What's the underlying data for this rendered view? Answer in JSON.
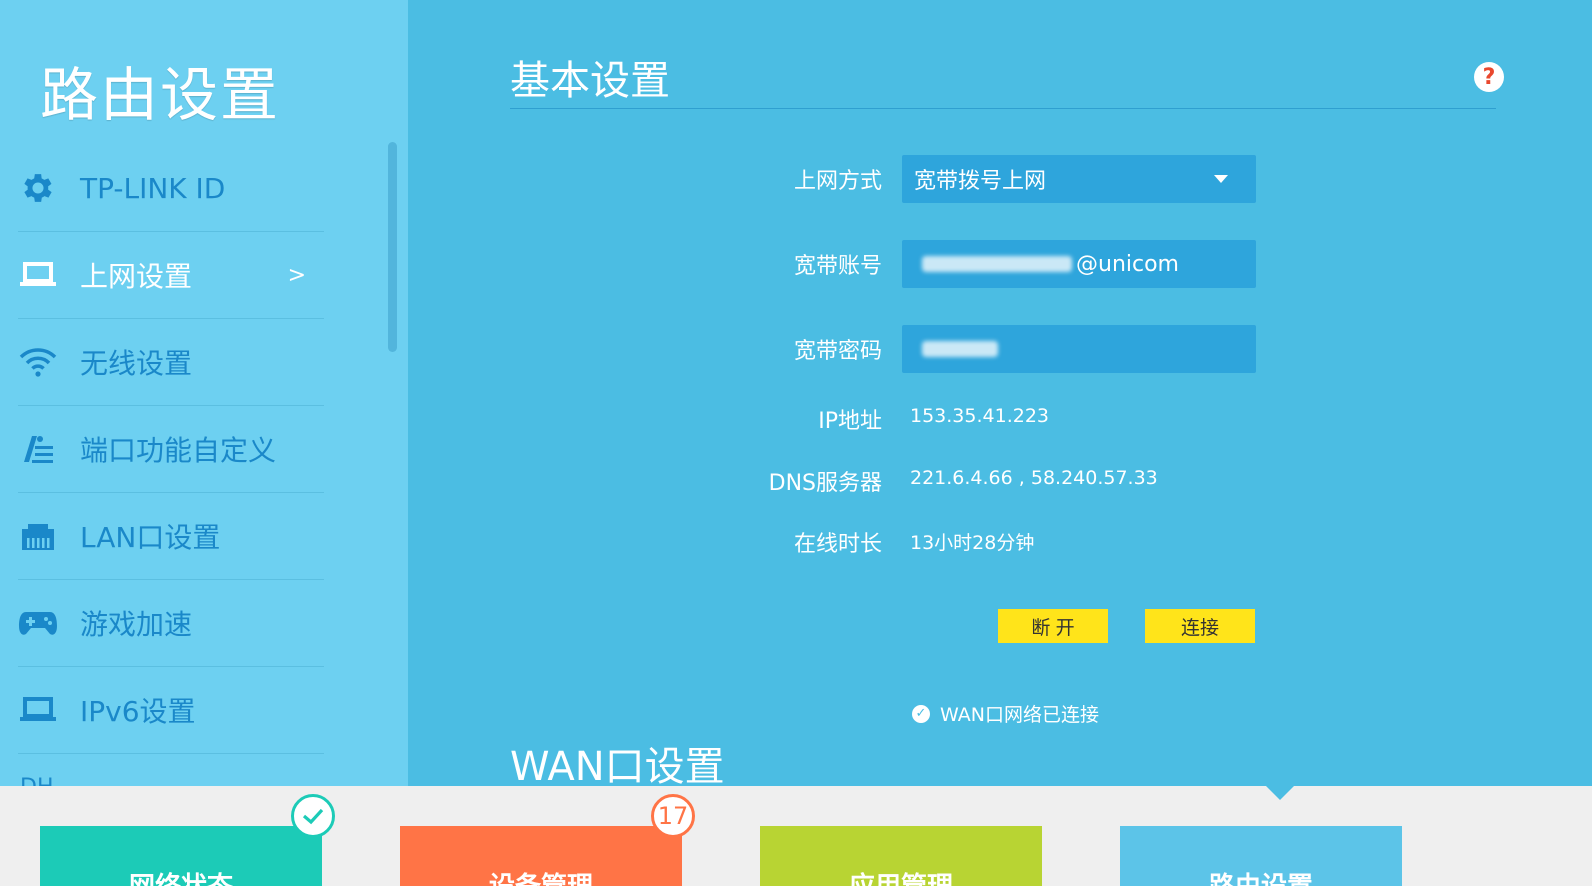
{
  "sidebar": {
    "title": "路由设置",
    "items": [
      {
        "label": "TP-LINK ID",
        "icon": "gear-icon"
      },
      {
        "label": "上网设置",
        "icon": "laptop-icon",
        "active": true,
        "chevron": ">"
      },
      {
        "label": "无线设置",
        "icon": "wifi-icon"
      },
      {
        "label": "端口功能自定义",
        "icon": "port-config-icon"
      },
      {
        "label": "LAN口设置",
        "icon": "lan-port-icon"
      },
      {
        "label": "游戏加速",
        "icon": "gamepad-icon"
      },
      {
        "label": "IPv6设置",
        "icon": "laptop-icon"
      }
    ],
    "partial_item": "DH"
  },
  "main": {
    "section_title": "基本设置",
    "help_glyph": "?",
    "form": {
      "connection_type_label": "上网方式",
      "connection_type_value": "宽带拨号上网",
      "account_label": "宽带账号",
      "account_value_suffix": "@unicom",
      "password_label": "宽带密码",
      "ip_label": "IP地址",
      "ip_value": "153.35.41.223",
      "dns_label": "DNS服务器",
      "dns_value": "221.6.4.66 , 58.240.57.33",
      "online_label": "在线时长",
      "online_value": "13小时28分钟"
    },
    "buttons": {
      "disconnect": "断 开",
      "connect": "连接"
    },
    "status_text": "WAN口网络已连接",
    "wan_section_title": "WAN口设置"
  },
  "bottom_tabs": [
    {
      "label": "网络状态",
      "color": "#1ccbb7",
      "badge": "check"
    },
    {
      "label": "设备管理",
      "color": "#ff7446",
      "badge": "17"
    },
    {
      "label": "应用管理",
      "color": "#b8d433"
    },
    {
      "label": "路由设置",
      "color": "#5cc4e8"
    }
  ],
  "colors": {
    "main_bg": "#4bbde3",
    "sidebar_bg": "#6dd0f1",
    "field_bg": "#2ea5dc",
    "button_yellow": "#ffe41a",
    "help_red": "#e9482e"
  }
}
